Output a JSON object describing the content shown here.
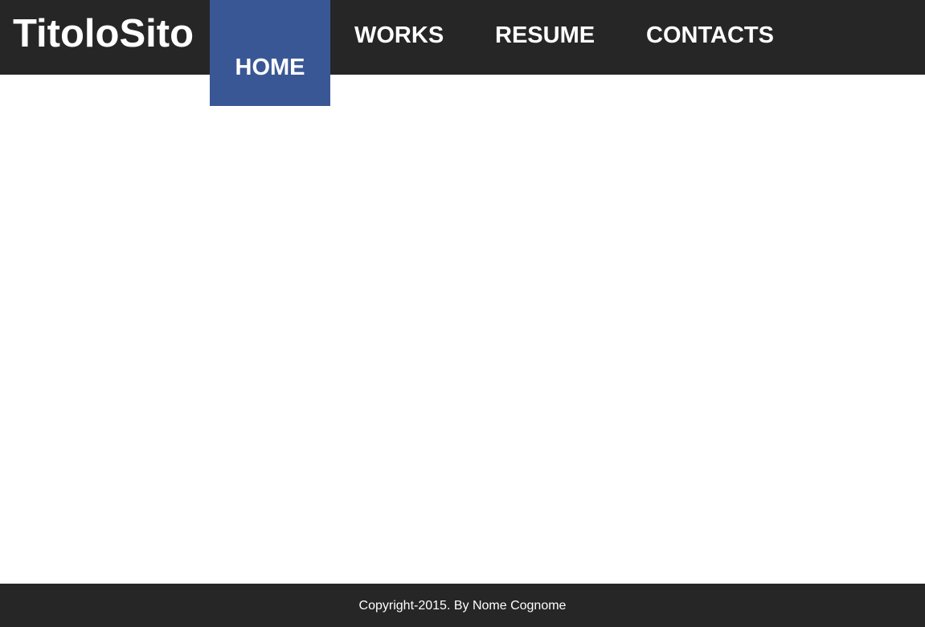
{
  "header": {
    "site_title": "TitoloSito",
    "nav": {
      "home": "HOME",
      "works": "WORKS",
      "resume": "RESUME",
      "contacts": "CONTACTS",
      "active": "home"
    }
  },
  "footer": {
    "copyright": "Copyright-2015. By Nome Cognome"
  },
  "colors": {
    "bar_background": "#262626",
    "active_nav_background": "#3a5795",
    "text": "#ffffff",
    "page_background": "#ffffff"
  }
}
